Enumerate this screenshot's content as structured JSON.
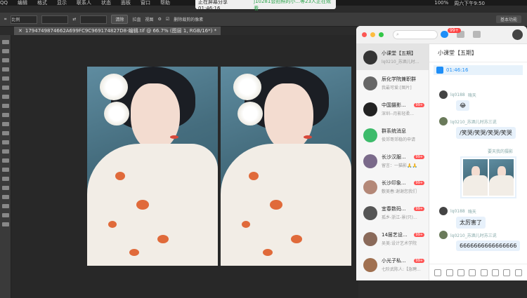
{
  "menubar": {
    "items": [
      "QQ",
      "编辑",
      "格式",
      "显示",
      "联系人",
      "状态",
      "面板",
      "窗口",
      "帮助"
    ],
    "battery": "100%",
    "datetime": "周六下午9:50"
  },
  "share_banner": {
    "status": "正在屏幕分享 01:46:16",
    "viewers": "j10281会拍照的小...等23人正在观看"
  },
  "options_bar": {
    "ratio_label": "比例",
    "clear_button": "清除",
    "straighten_label": "拉直",
    "view_label": "视图",
    "delete_pixels_label": "删除裁剪的像素",
    "workspace": "基本功能"
  },
  "document": {
    "tab_title": "1794749874662A699FC9C969174827D8-编辑.tif @ 66.7% (图层 1, RGB/16*) *"
  },
  "qq": {
    "search_placeholder": "搜索",
    "message_badge": "99+",
    "conversations": [
      {
        "name": "小课堂【五期】",
        "preview": "lq0210_苏酒儿时...",
        "count": "",
        "color": "#333"
      },
      {
        "name": "辰化学院兼职群",
        "preview": "我最可爱:[图片]",
        "count": "",
        "color": "#666"
      },
      {
        "name": "中国摄影...",
        "preview": "深圳--月影轻柔...",
        "count": "99+",
        "color": "#222"
      },
      {
        "name": "群系统消息",
        "preview": "俊郊哥郊稳的申请",
        "count": "",
        "color": "#3dbb6b"
      },
      {
        "name": "长沙汉服...",
        "preview": "留言：一猫影🙏🙏",
        "count": "99+",
        "color": "#7a6a8a"
      },
      {
        "name": "长沙印象...",
        "preview": "敷美春:谢谢您我们",
        "count": "99+",
        "color": "#b48878"
      },
      {
        "name": "宜春数码...",
        "preview": "孤乡-浙江-景(只)...",
        "count": "99+",
        "color": "#555"
      },
      {
        "name": "14届艺设...",
        "preview": "吴美:设计艺术学院",
        "count": "99+",
        "color": "#8a6a5a"
      },
      {
        "name": "小光子私...",
        "preview": "七阶武陈人:【急聘...",
        "count": "99+",
        "color": "#a07050"
      }
    ],
    "chat": {
      "title": "小课堂【五期】",
      "announcement": "01:46:16",
      "msg1_sender": "lq0188",
      "msg1_tag": "嗨天",
      "msg1_text": "😂",
      "msg2_sender": "lq0210_苏酒儿时苏三说",
      "msg2_text": "/笑哭/笑哭/笑哭/笑哭",
      "msg3_sender": "要天我的摄影",
      "msg4_sender": "lq0188",
      "msg4_tag": "嗨天",
      "msg4_text": "太厉害了",
      "msg5_sender": "lq0210_苏酒儿时苏三说",
      "msg5_text": "6666666666666666"
    }
  }
}
